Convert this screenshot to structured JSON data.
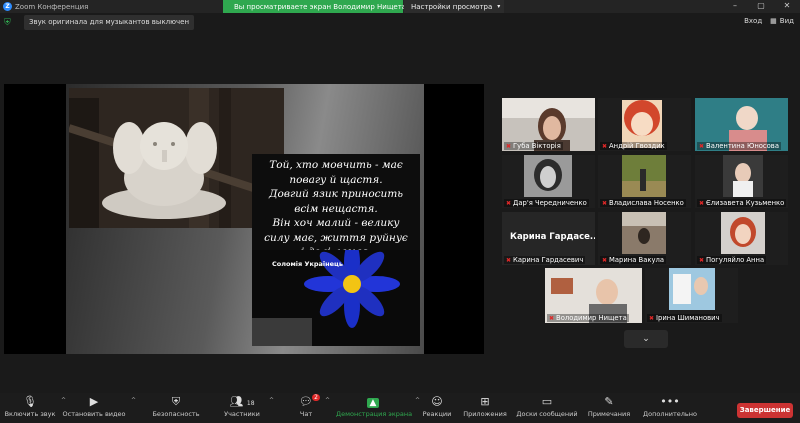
{
  "window": {
    "title": "Zoom Конференция",
    "logo_letter": "Z",
    "controls": [
      "–",
      "▢",
      "✕"
    ]
  },
  "banner": {
    "sharing": "Вы просматриваете экран Володимир Нищета",
    "view_options": "Настройки просмотра"
  },
  "audio_notice": "Звук оригинала для музыкантов выключен",
  "top_buttons": {
    "exit": "Вход",
    "view": "Вид"
  },
  "slide": {
    "quote_lines": [
      "Той, хто мовчить - має",
      "повагу й щастя.",
      "Довгий язик приносить",
      "всім нещастя.",
      "Він хоч малий  - велику",
      "силу має, життя руйнує",
      "і долі ламає."
    ],
    "author": "Соломія Українець"
  },
  "gallery": [
    {
      "name": "Губа Вікторія"
    },
    {
      "name": "Андрій Гвоздик"
    },
    {
      "name": "Валентина Юносова"
    },
    {
      "name": "Дар'я Чередниченко"
    },
    {
      "name": "Владислава Носенко"
    },
    {
      "name": "Єлизавета Кузьменко"
    },
    {
      "name": "Карина Гардасевич",
      "big": "Карина  Гардасе..."
    },
    {
      "name": "Марина Вакула"
    },
    {
      "name": "Погуляйло Анна"
    },
    {
      "name": "Володимир Нищета"
    },
    {
      "name": "Ірина Шиманович"
    }
  ],
  "toolbar": {
    "mute": "Включить звук",
    "video": "Остановить видео",
    "security": "Безопасность",
    "participants": "Участники",
    "participants_count": "18",
    "chat": "Чат",
    "chat_badge": "2",
    "share": "Демонстрация экрана",
    "reactions": "Реакции",
    "apps": "Приложения",
    "whiteboard": "Доски сообщений",
    "notes": "Примечания",
    "more": "Дополнительно",
    "end": "Завершение"
  },
  "colors": {
    "accent_green": "#2fa84f",
    "end_red": "#cc3333",
    "active_speaker": "#d8f06a"
  }
}
